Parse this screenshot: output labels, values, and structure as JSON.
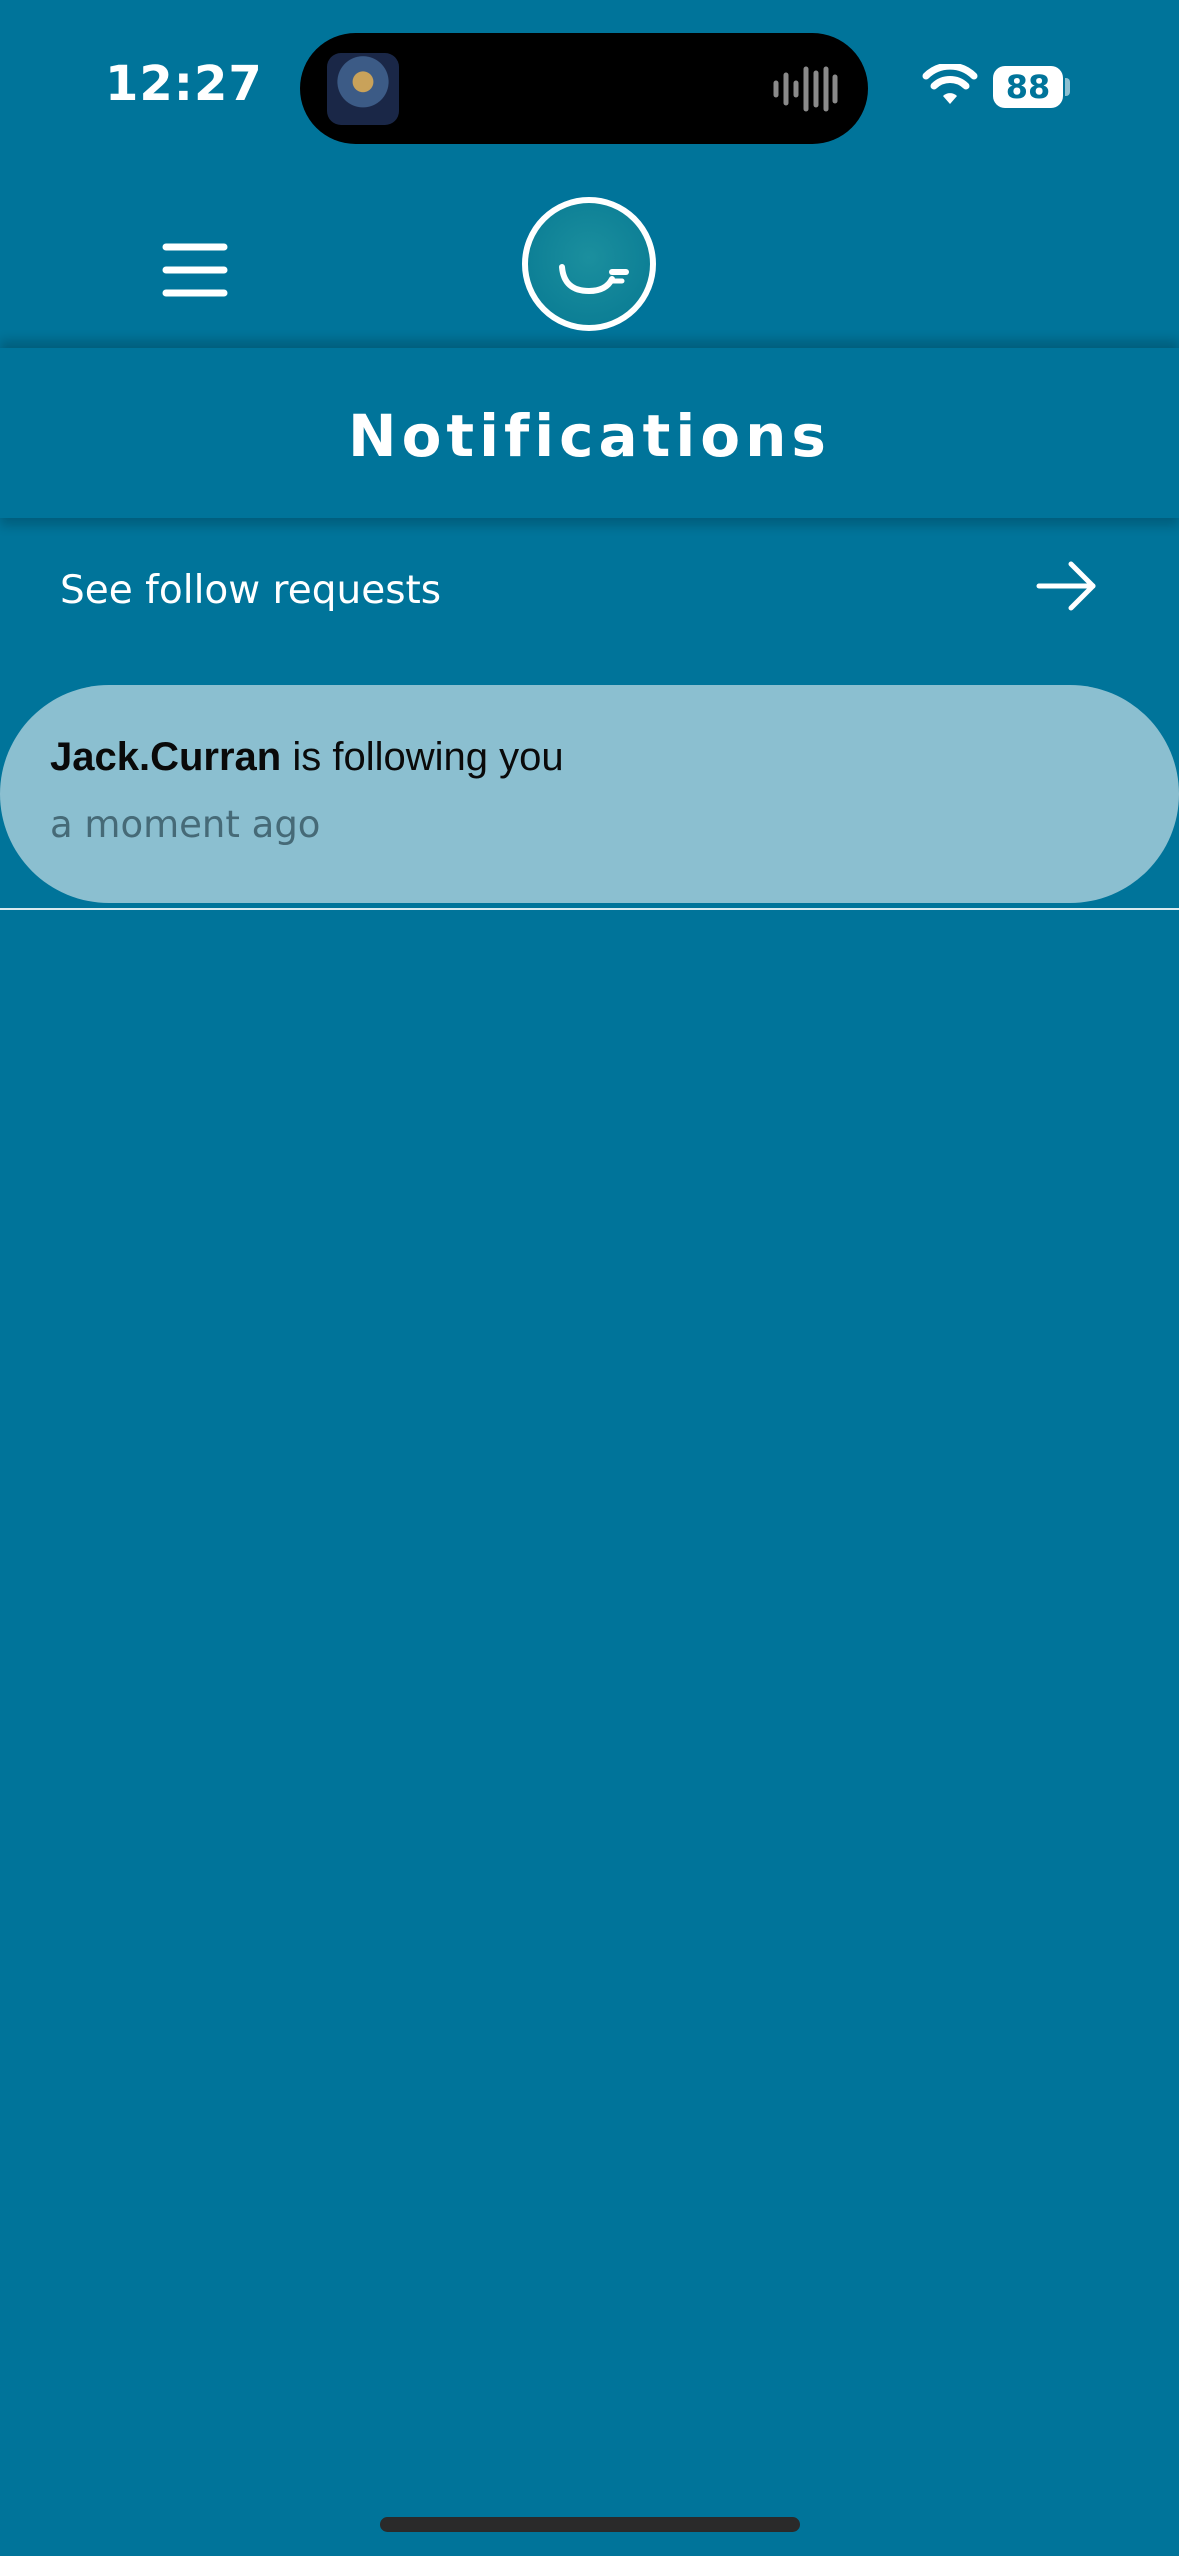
{
  "status_bar": {
    "time": "12:27",
    "battery": "88"
  },
  "header": {
    "menu_icon": "hamburger-menu-icon",
    "logo_icon": "smile-logo-icon"
  },
  "page": {
    "title": "Notifications"
  },
  "follow_requests": {
    "label": "See follow requests",
    "icon": "arrow-right-icon"
  },
  "notifications": [
    {
      "user": "Jack.Curran",
      "message": " is following you",
      "time": "a moment ago"
    }
  ],
  "colors": {
    "background": "#00749A",
    "card": "#8BBFD0",
    "text": "#FFFFFF",
    "muted": "#466A77"
  }
}
